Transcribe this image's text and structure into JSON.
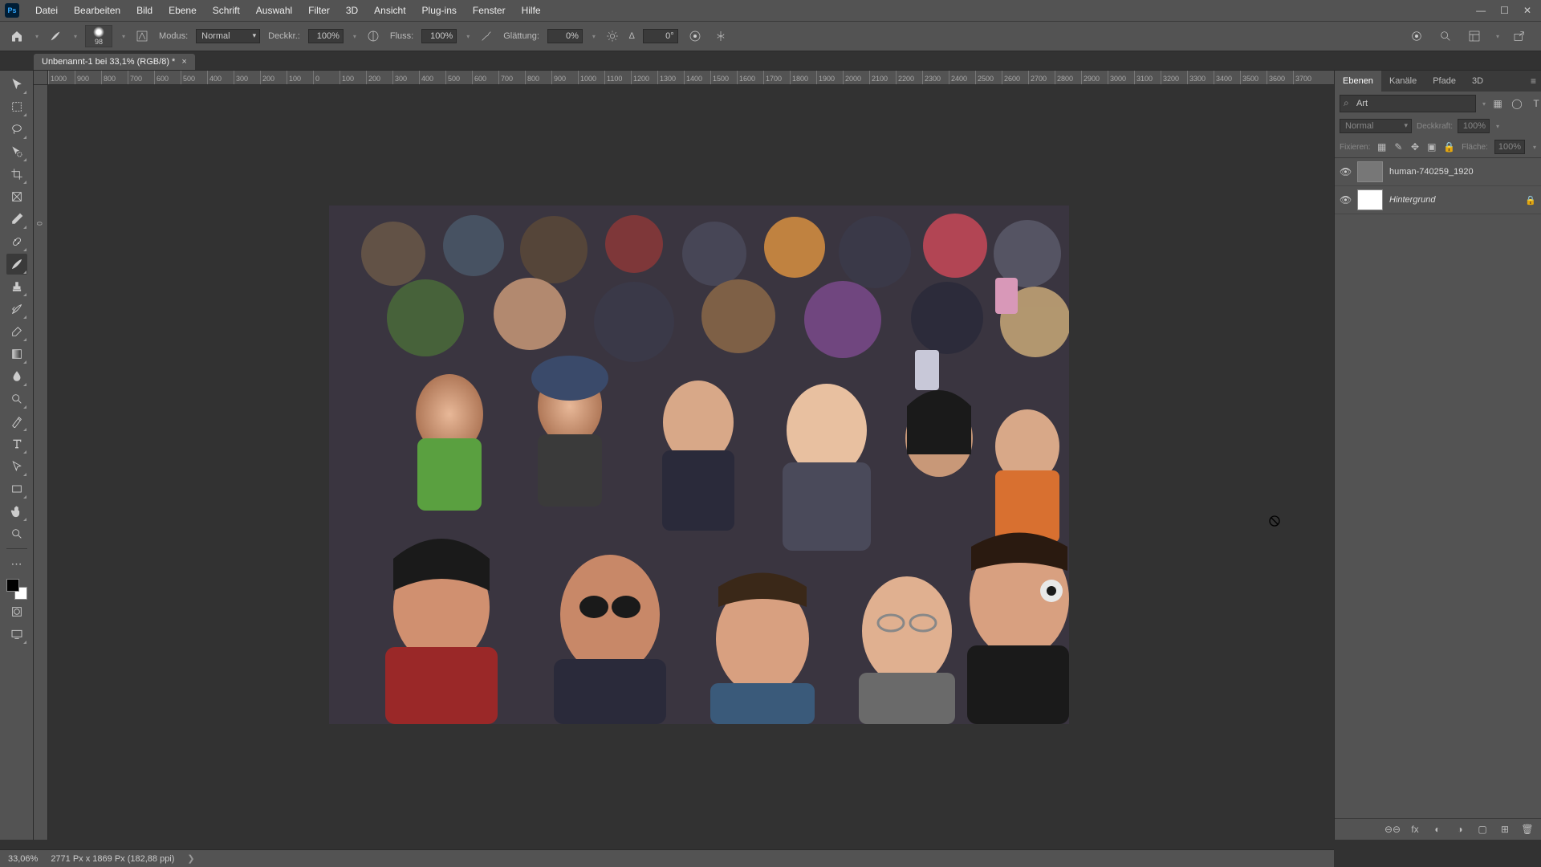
{
  "menu": {
    "items": [
      "Datei",
      "Bearbeiten",
      "Bild",
      "Ebene",
      "Schrift",
      "Auswahl",
      "Filter",
      "3D",
      "Ansicht",
      "Plug-ins",
      "Fenster",
      "Hilfe"
    ],
    "logo": "Ps"
  },
  "options": {
    "brush_size": "98",
    "modus_label": "Modus:",
    "modus_value": "Normal",
    "deckkraft_label": "Deckkr.:",
    "deckkraft_value": "100%",
    "fluss_label": "Fluss:",
    "fluss_value": "100%",
    "glaettung_label": "Glättung:",
    "glaettung_value": "0%",
    "angle_label": "∆",
    "angle_value": "0°"
  },
  "doc_tab": {
    "title": "Unbenannt-1 bei 33,1% (RGB/8) *",
    "close": "×"
  },
  "ruler_ticks": [
    "1000",
    "900",
    "800",
    "700",
    "600",
    "500",
    "400",
    "300",
    "200",
    "100",
    "0",
    "100",
    "200",
    "300",
    "400",
    "500",
    "600",
    "700",
    "800",
    "900",
    "1000",
    "1100",
    "1200",
    "1300",
    "1400",
    "1500",
    "1600",
    "1700",
    "1800",
    "1900",
    "2000",
    "2100",
    "2200",
    "2300",
    "2400",
    "2500",
    "2600",
    "2700",
    "2800",
    "2900",
    "3000",
    "3100",
    "3200",
    "3300",
    "3400",
    "3500",
    "3600",
    "3700"
  ],
  "ruler_v_zero": "0",
  "panels": {
    "tabs": [
      "Ebenen",
      "Kanäle",
      "Pfade",
      "3D"
    ],
    "search_prefix": "Q",
    "search_value": "Art",
    "blend_mode": "Normal",
    "opacity_label": "Deckkraft:",
    "opacity_value": "100%",
    "lock_label": "Fixieren:",
    "fill_label": "Fläche:",
    "fill_value": "100%",
    "layers": [
      {
        "name": "human-740259_1920",
        "locked": false,
        "italic": false
      },
      {
        "name": "Hintergrund",
        "locked": true,
        "italic": true
      }
    ],
    "footer_icons": [
      "⊖⊖",
      "fx",
      "◐",
      "◑",
      "▢",
      "⊞",
      "🗑"
    ]
  },
  "status": {
    "zoom": "33,06%",
    "doc_info": "2771 Px x 1869 Px (182,88 ppi)",
    "arrow": "❯"
  },
  "window_controls": {
    "min": "—",
    "max": "☐",
    "close": "✕"
  },
  "icons": {
    "home": "⌂",
    "search": "⌕",
    "frame": "▦",
    "share": "↗",
    "toggle": "⊡",
    "pressure": "✎",
    "airbrush": "✈",
    "gear": "⚙",
    "symm": "⦵",
    "butterfly": "✱",
    "link": "⊖⊖",
    "fx": "fx",
    "mask": "◐",
    "adj": "◑",
    "group": "▢",
    "new": "⊞",
    "trash": "🗑",
    "img": "▦",
    "circle": "◯",
    "T": "T",
    "box": "▢",
    "align": "≡"
  }
}
